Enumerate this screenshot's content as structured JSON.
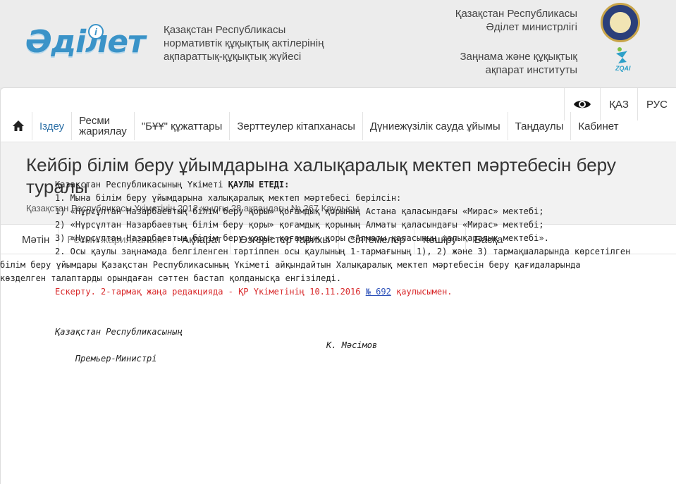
{
  "header": {
    "logo_text": "Әділет",
    "tagline": [
      "Қазақстан Республикасы",
      "нормативтік құқықтық актілерінің",
      "ақпараттық-құқықтық жүйесі"
    ],
    "org1": [
      "Қазақстан Республикасы",
      "Әділет министрлігі"
    ],
    "org2": [
      "Заңнама және құқықтық",
      "ақпарат институты"
    ],
    "zqai_label": "ZQAI"
  },
  "lang": {
    "kaz": "ҚАЗ",
    "rus": "РУС"
  },
  "nav": {
    "items": [
      "Іздеу",
      "Ресми",
      "жариялау",
      "\"БҰҰ\" құжаттары",
      "Зерттеулер кітапханасы",
      "Дүниежүзілік сауда ұйымы",
      "Таңдаулы",
      "Кабинет"
    ]
  },
  "document": {
    "title": "Кейбір білім беру ұйымдарына халықаралық мектеп мәртебесін беру туралы",
    "subtitle": "Қазақстан Республикасы Үкіметінің 2012 жылғы 28 ақпандағы № 267 Қаулысы"
  },
  "tabs": [
    "Мәтін",
    "Ресми жарияланым",
    "Ақпарат",
    "Өзгерістер тарихы",
    "Сілтемелер",
    "Көшіру",
    "Басқа"
  ],
  "content": {
    "intro_prefix": "Қазақстан Республикасының Үкіметі ",
    "intro_bold": "ҚАУЛЫ ЕТЕДІ:",
    "p1": "1. Мына білім беру ұйымдарына халықаралық мектеп мәртебесі берілсін:",
    "p1_1": "1) «Нұрсұлтан Назарбаевтың білім беру қоры» қоғамдық қорының Астана қаласындағы «Мирас» мектебі;",
    "p1_2": "2) «Нұрсұлтан Назарбаевтың білім беру қоры» қоғамдық қорының Алматы қаласындағы «Мирас» мектебі;",
    "p1_3": "3) «Нұрсұлтан Назарбаевтың білім беру қоры» қоғамдық қоры «Алматы қаласының халықаралық мектебі».",
    "p2_first": "2. Осы қаулы заңнамада белгіленген тәртіппен осы қаулының 1-тармағының 1), 2) және 3) тармақшаларында көрсетілген",
    "p2_rest": [
      "білім беру ұйымдары Қазақстан Республикасының Үкіметі айқындайтын Халықаралық мектеп мәртебесін беру қағидаларында",
      "көзделген талаптарды орындаған сәттен бастап қолданысқа енгізіледі."
    ],
    "note_prefix": "Ескерту. 2-тармақ жаңа редакцияда - ҚР Үкіметінің 10.11.2016 ",
    "note_link": "№ 692",
    "note_suffix": " қаулысымен.",
    "sig_line1": "Қазақстан Республикасының",
    "sig_role": "Премьер-Министрі",
    "sig_name": "К. Мәсімов"
  }
}
